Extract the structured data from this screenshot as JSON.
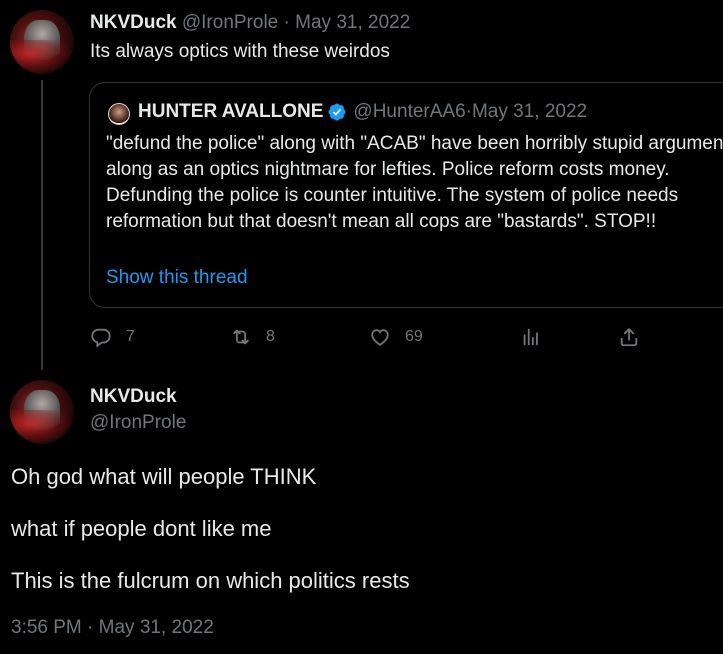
{
  "tweet1": {
    "name": "NKVDuck",
    "handle": "@IronProle",
    "separator": " · ",
    "date": "May 31, 2022",
    "text": "Its always optics with these weirdos"
  },
  "quote": {
    "name": "HUNTER AVALLONE",
    "handle": "@HunterAA6",
    "separator": " · ",
    "date": "May 31, 2022",
    "text": "\"defund the police\" along with \"ACAB\" have been horribly stupid arguments along as an optics nightmare for lefties. Police reform costs money. Defunding the police is counter intuitive. The system of police needs reformation but that doesn't mean all cops are \"bastards\". STOP!!",
    "show_thread": "Show this thread"
  },
  "actions": {
    "reply_count": "7",
    "retweet_count": "8",
    "like_count": "69"
  },
  "tweet2": {
    "name": "NKVDuck",
    "handle": "@IronProle",
    "lines": [
      "Oh god what will people THINK",
      "what if people dont like me",
      "This is the fulcrum on which politics rests"
    ],
    "timestamp": "3:56 PM · May 31, 2022"
  },
  "colors": {
    "background": "#000000",
    "text": "#e7e9ea",
    "muted": "#71767b",
    "link": "#1d9bf0",
    "verified": "#1d9bf0",
    "border": "#2f3336"
  },
  "icons": {
    "reply": "reply-icon",
    "retweet": "retweet-icon",
    "like": "heart-icon",
    "views": "analytics-icon",
    "share": "share-icon",
    "verified": "verified-badge-icon"
  }
}
